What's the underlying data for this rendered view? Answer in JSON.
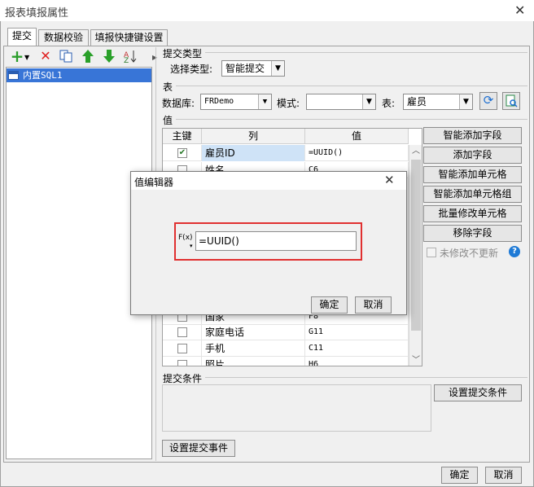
{
  "window": {
    "title": "报表填报属性",
    "close_icon": "✕"
  },
  "tabs": [
    {
      "label": "提交",
      "active": true
    },
    {
      "label": "数据校验",
      "active": false
    },
    {
      "label": "填报快捷键设置",
      "active": false
    }
  ],
  "tree": {
    "item": "内置SQL1"
  },
  "submit_type": {
    "group_label": "提交类型",
    "select_label": "选择类型:",
    "value": "智能提交"
  },
  "table_section": {
    "group_label": "表",
    "db_label": "数据库:",
    "db_value": "FRDemo",
    "mode_label": "模式:",
    "mode_value": "",
    "table_label": "表:",
    "table_value": "雇员"
  },
  "values_section": {
    "group_label": "值",
    "headers": [
      "主键",
      "列",
      "值"
    ],
    "rows": [
      {
        "key": true,
        "column": "雇员ID",
        "value": "=UUID()"
      },
      {
        "key": false,
        "column": "姓名",
        "value": "C6"
      },
      {
        "key": false,
        "column": "国家",
        "value": "F8"
      },
      {
        "key": false,
        "column": "家庭电话",
        "value": "G11"
      },
      {
        "key": false,
        "column": "手机",
        "value": "C11"
      },
      {
        "key": false,
        "column": "照片",
        "value": "H6"
      }
    ]
  },
  "side_buttons": [
    "智能添加字段",
    "添加字段",
    "智能添加单元格",
    "智能添加单元格组",
    "批量修改单元格",
    "移除字段"
  ],
  "no_update_checkbox": "未修改不更新",
  "submit_condition": {
    "group_label": "提交条件",
    "button": "设置提交条件"
  },
  "submit_event_button": "设置提交事件",
  "footer": {
    "ok": "确定",
    "cancel": "取消"
  },
  "dialog": {
    "title": "值编辑器",
    "fx_label": "F(x)",
    "formula_value": "=UUID()",
    "ok": "确定",
    "cancel": "取消"
  },
  "colors": {
    "selection": "#3875d7",
    "highlight_border": "#e03030",
    "help_icon": "#1e7ad6"
  }
}
